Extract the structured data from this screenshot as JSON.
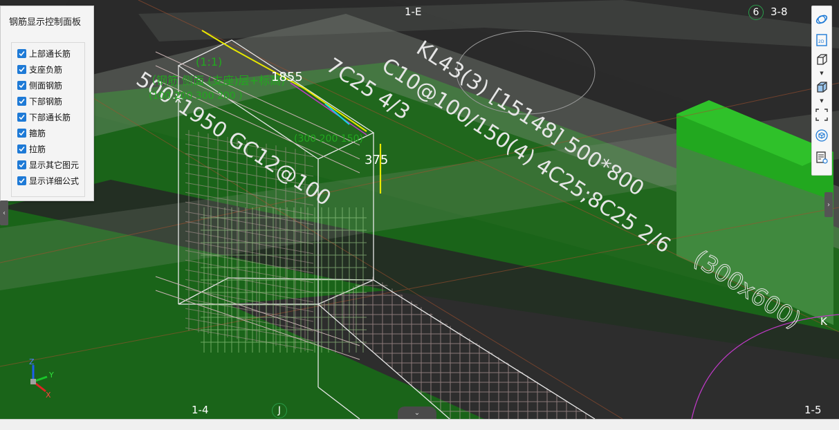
{
  "panel": {
    "title": "钢筋显示控制面板",
    "options": [
      {
        "label": "上部通长筋",
        "checked": true
      },
      {
        "label": "支座负筋",
        "checked": true
      },
      {
        "label": "侧面钢筋",
        "checked": true
      },
      {
        "label": "下部钢筋",
        "checked": true
      },
      {
        "label": "下部通长筋",
        "checked": true
      },
      {
        "label": "箍筋",
        "checked": true
      },
      {
        "label": "拉筋",
        "checked": true
      },
      {
        "label": "显示其它图元",
        "checked": true
      },
      {
        "label": "显示详细公式",
        "checked": true
      }
    ]
  },
  "toolbar": {
    "items": [
      "orbit-icon",
      "2d-view-icon",
      "box-wireframe-icon",
      "box-solid-icon",
      "fit-view-icon",
      "gear-cube-icon",
      "properties-icon"
    ],
    "label_2d": "2D"
  },
  "axes": {
    "top_center": "1-E",
    "top_right_circle": "6",
    "top_right": "3-8",
    "bottom_left": "1-4",
    "bottom_circle": "J",
    "bottom_right": "1-5",
    "right": "K"
  },
  "gizmo": {
    "x": "X",
    "y": "Y",
    "z": "Z"
  },
  "dims": {
    "d1855": "1855",
    "d375": "375"
  },
  "annotations": {
    "beam_label": "KL43(3) [15148] 500*800",
    "stirrup_spec": "C10@100/150(4) 4C25;8C25 2/6",
    "top_bars": "7C25 4/3",
    "section": "(300x600)",
    "column_spec": "500*1950 GC12@100",
    "green1": "(1:1)",
    "green2": "（钢筋 侧面 (支座)层+标高)",
    "green3": "(100 200 300 200 )",
    "green4": "(300 200 150)"
  },
  "colors": {
    "green_slab": "#1f7a1c",
    "green_bright": "#22a81f",
    "beam_gray": "#7d8a7b",
    "rebar_pink": "#b79c9c",
    "accent_blue": "#1e7ad6"
  }
}
